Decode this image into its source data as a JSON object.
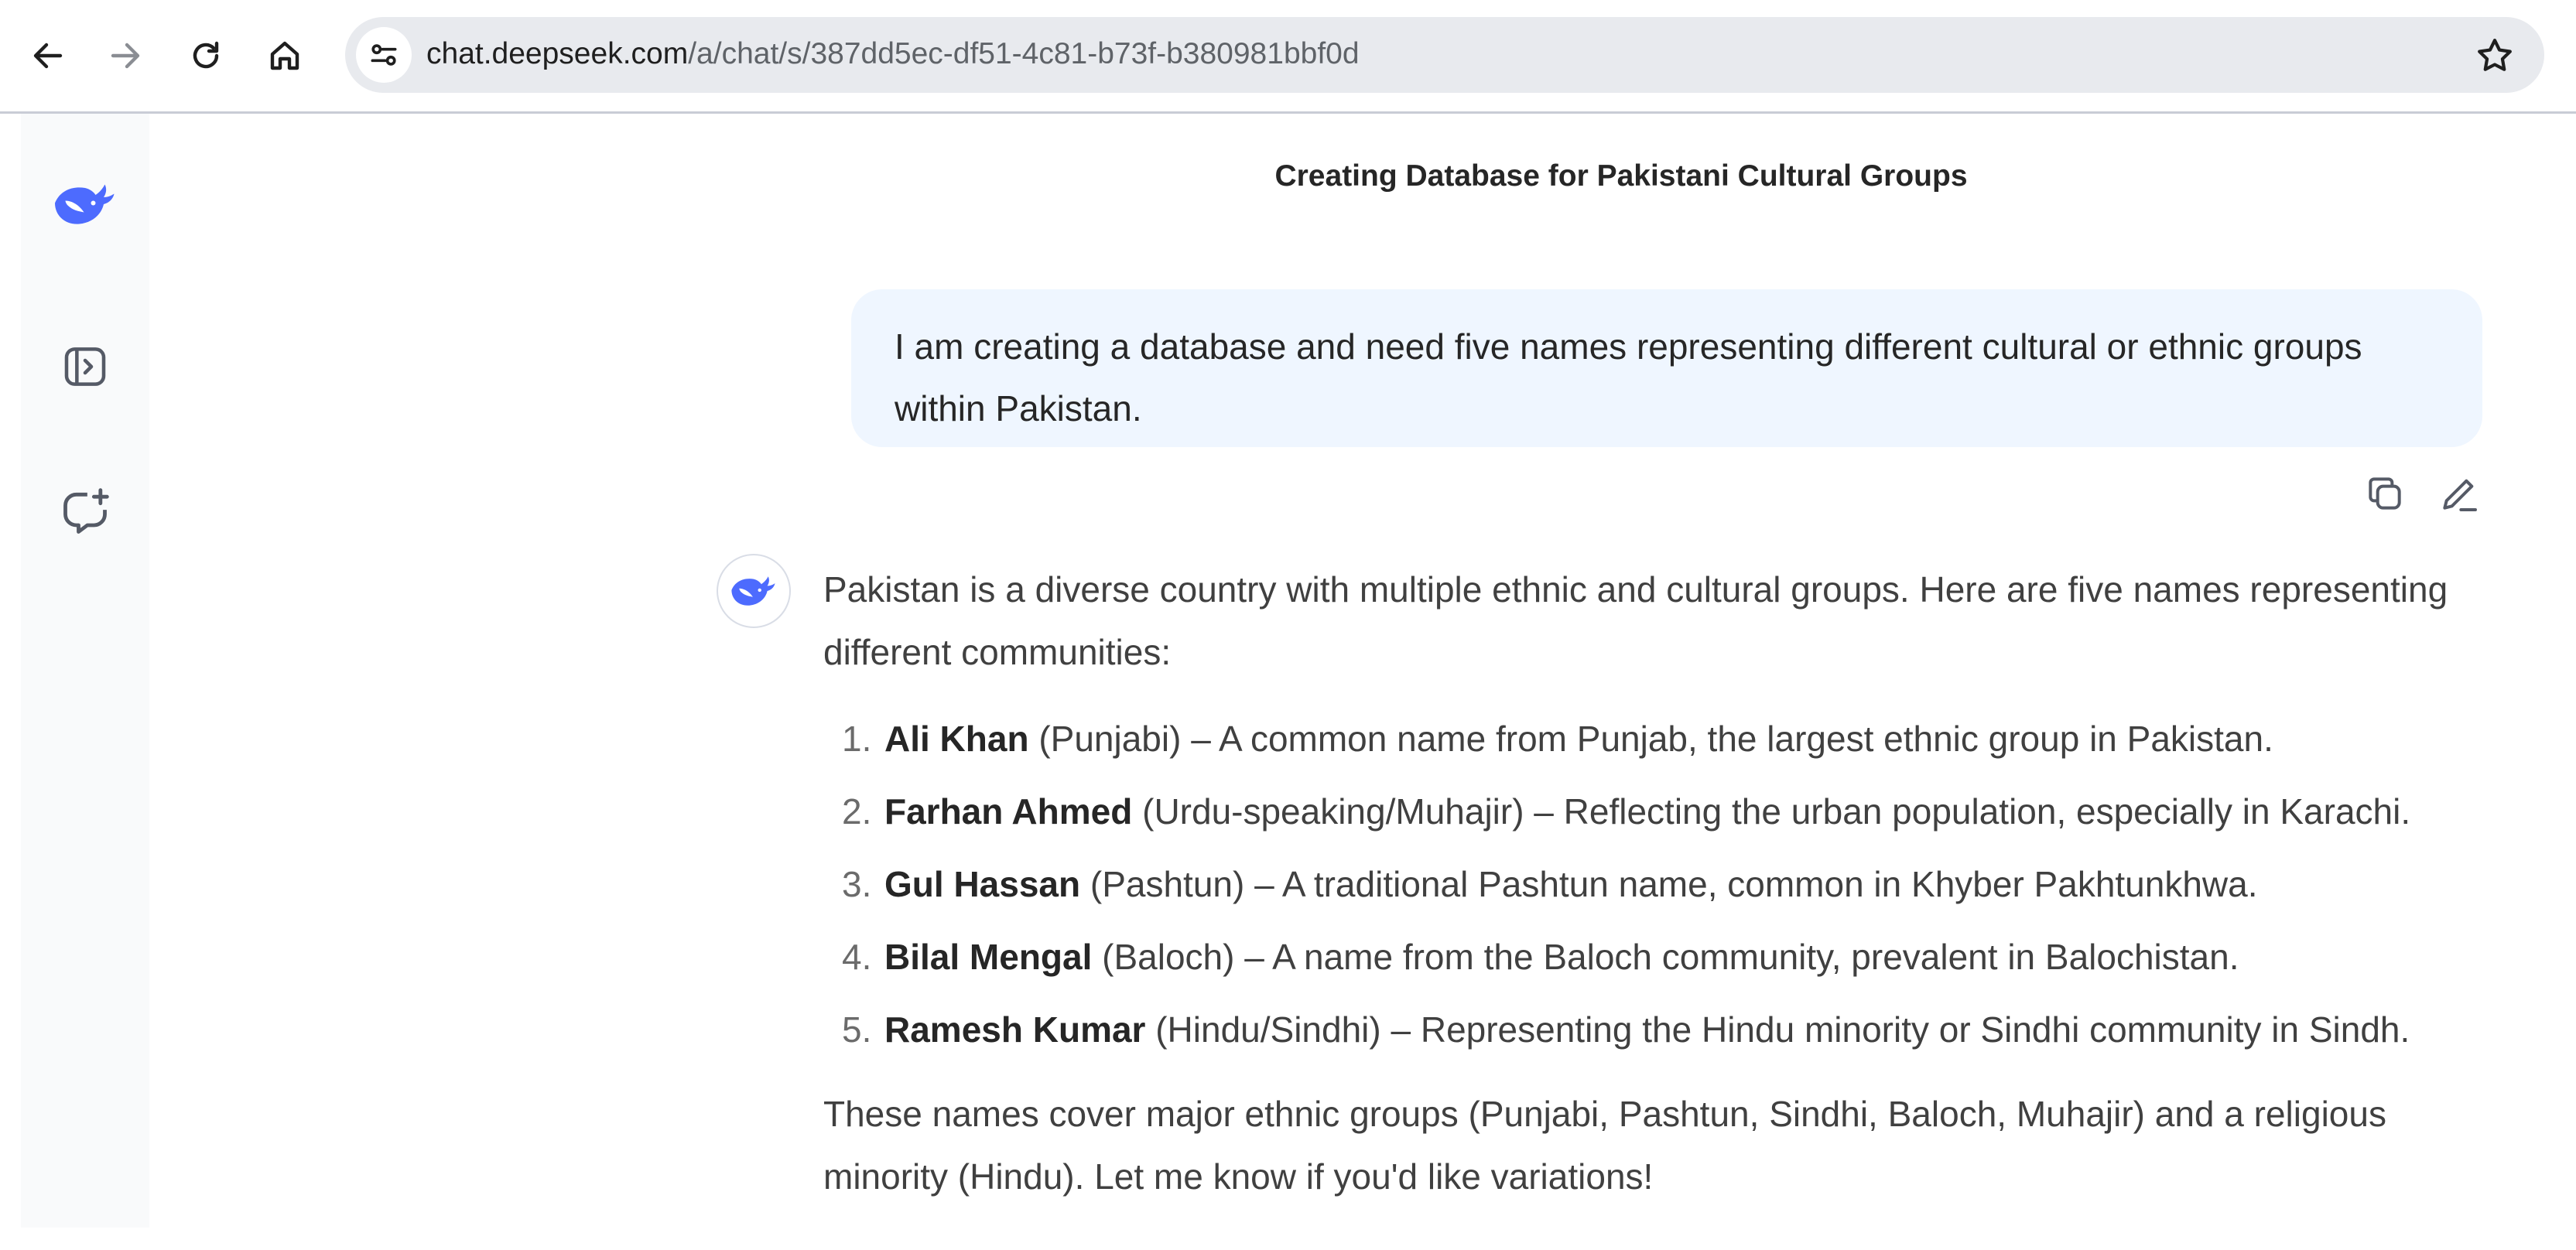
{
  "browser": {
    "url_host": "chat.deepseek.com",
    "url_path": "/a/chat/s/387dd5ec-df51-4c81-b73f-b380981bbf0d",
    "icons": [
      "back-arrow-icon",
      "forward-arrow-icon",
      "reload-icon",
      "home-icon",
      "site-info-icon",
      "star-icon"
    ]
  },
  "sidebar": {
    "icons": [
      "deepseek-logo-icon",
      "open-sidebar-icon",
      "new-chat-icon"
    ]
  },
  "chat": {
    "title": "Creating Database for Pakistani Cultural Groups",
    "user_message": "I am creating a database and need five names representing different cultural or ethnic groups within Pakistan.",
    "assistant": {
      "intro": "Pakistan is a diverse country with multiple ethnic and cultural groups. Here are five names representing different communities:",
      "items": [
        {
          "num": "1.",
          "name": "Ali Khan",
          "rest": " (Punjabi) – A common name from Punjab, the largest ethnic group in Pakistan."
        },
        {
          "num": "2.",
          "name": "Farhan Ahmed",
          "rest": " (Urdu-speaking/Muhajir) – Reflecting the urban population, especially in Karachi."
        },
        {
          "num": "3.",
          "name": "Gul Hassan",
          "rest": " (Pashtun) – A traditional Pashtun name, common in Khyber Pakhtunkhwa."
        },
        {
          "num": "4.",
          "name": "Bilal Mengal",
          "rest": " (Baloch) – A name from the Baloch community, prevalent in Balochistan."
        },
        {
          "num": "5.",
          "name": "Ramesh Kumar",
          "rest": " (Hindu/Sindhi) – Representing the Hindu minority or Sindhi community in Sindh."
        }
      ],
      "outro": "These names cover major ethnic groups (Punjabi, Pashtun, Sindhi, Baloch, Muhajir) and a religious minority (Hindu). Let me know if you'd like variations!"
    },
    "message_actions": [
      "copy-icon",
      "edit-icon"
    ]
  },
  "colors": {
    "brand_blue": "#4d6bfe",
    "user_bubble": "#eff6ff",
    "sidebar_bg": "#f9fafb",
    "omnibox_bg": "#e8eaee"
  }
}
